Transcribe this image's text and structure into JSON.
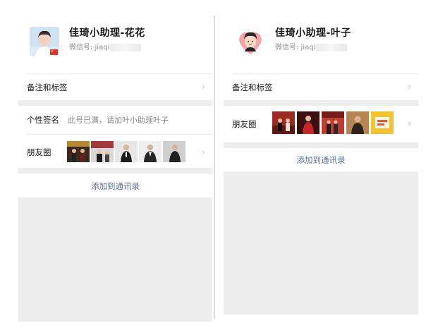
{
  "left_profile": {
    "name": "佳琦小助理-花花",
    "wechat_id_label": "微信号: jiaqi",
    "remarks_label": "备注和标签",
    "signature_label": "个性签名",
    "signature_value": "此号已满，请加叶小助理叶子",
    "moments_label": "朋友圈",
    "add_button": "添加到通讯录",
    "chevron": "›"
  },
  "right_profile": {
    "name": "佳琦小助理-叶子",
    "wechat_id_label": "微信号: jiaqi",
    "remarks_label": "备注和标签",
    "moments_label": "朋友圈",
    "add_button": "添加到通讯录",
    "chevron": "›"
  },
  "colors": {
    "link": "#576b95",
    "background_gray": "#ededed",
    "secondary_text": "#888888"
  }
}
